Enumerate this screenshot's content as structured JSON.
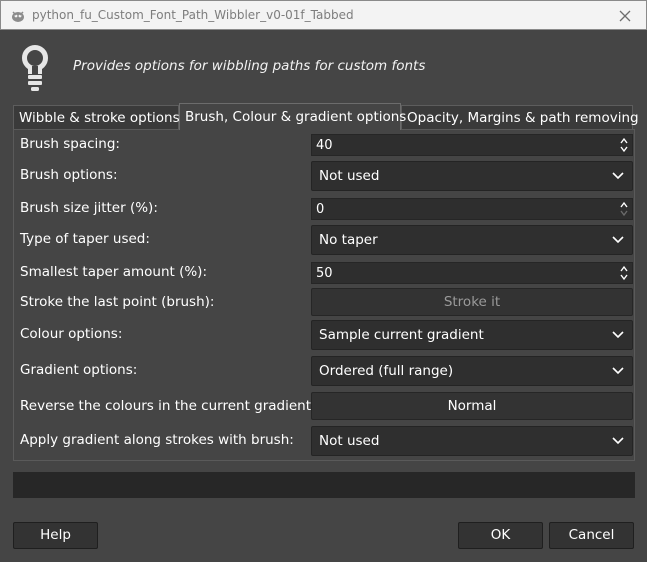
{
  "window": {
    "title": "python_fu_Custom_Font_Path_Wibbler_v0-01f_Tabbed",
    "icon": "gimp-icon",
    "close_icon": "close-icon"
  },
  "header": {
    "icon": "lightbulb-icon",
    "description": "Provides options for wibbling paths for custom fonts"
  },
  "tabs": [
    {
      "label": "Wibble & stroke options",
      "active": false
    },
    {
      "label": "Brush, Colour & gradient options",
      "active": true
    },
    {
      "label": "Opacity, Margins & path removing",
      "active": false
    }
  ],
  "fields": [
    {
      "label": "Brush spacing:",
      "kind": "spinbox",
      "value": "40"
    },
    {
      "label": "Brush options:",
      "kind": "dropdown",
      "value": "Not used"
    },
    {
      "label": "Brush size jitter (%):",
      "kind": "spinbox",
      "value": "0"
    },
    {
      "label": "Type of taper used:",
      "kind": "dropdown",
      "value": "No taper"
    },
    {
      "label": "Smallest taper amount (%):",
      "kind": "spinbox",
      "value": "50"
    },
    {
      "label": "Stroke the last point (brush):",
      "kind": "button",
      "value": "Stroke it"
    },
    {
      "label": "Colour options:",
      "kind": "dropdown",
      "value": "Sample current gradient"
    },
    {
      "label": "Gradient options:",
      "kind": "dropdown",
      "value": "Ordered (full range)"
    },
    {
      "label": "Reverse the colours in the current gradient:",
      "kind": "button",
      "value": "Normal"
    },
    {
      "label": "Apply gradient along strokes with brush:",
      "kind": "dropdown",
      "value": "Not used"
    }
  ],
  "progress": {
    "value": 0
  },
  "buttons": {
    "help": "Help",
    "ok": "OK",
    "cancel": "Cancel"
  },
  "colors": {
    "background": "#454545",
    "field": "#2e2e2e",
    "titlebar": "#f3f3f3"
  }
}
